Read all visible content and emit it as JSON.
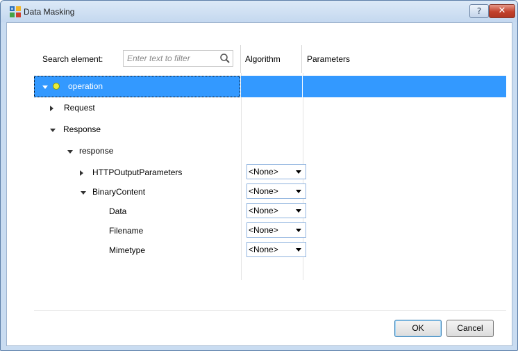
{
  "window": {
    "title": "Data Masking",
    "help_glyph": "?",
    "close_glyph": "✕"
  },
  "search": {
    "label": "Search element:",
    "placeholder": "Enter text to filter"
  },
  "columns": {
    "algorithm": "Algorithm",
    "parameters": "Parameters"
  },
  "tree": [
    {
      "label": "operation",
      "state": "expanded",
      "selected": true,
      "icon": "operation-node-icon"
    },
    {
      "label": "Request",
      "state": "collapsed"
    },
    {
      "label": "Response",
      "state": "expanded"
    },
    {
      "label": "response",
      "state": "expanded"
    },
    {
      "label": "HTTPOutputParameters",
      "state": "collapsed",
      "algorithm": "<None>"
    },
    {
      "label": "BinaryContent",
      "state": "expanded",
      "algorithm": "<None>"
    },
    {
      "label": "Data",
      "state": "leaf",
      "algorithm": "<None>"
    },
    {
      "label": "Filename",
      "state": "leaf",
      "algorithm": "<None>"
    },
    {
      "label": "Mimetype",
      "state": "leaf",
      "algorithm": "<None>"
    }
  ],
  "buttons": {
    "ok": "OK",
    "cancel": "Cancel"
  },
  "colors": {
    "selection": "#3399ff",
    "titlebar": "#c4d8ef",
    "close": "#c2412b"
  }
}
